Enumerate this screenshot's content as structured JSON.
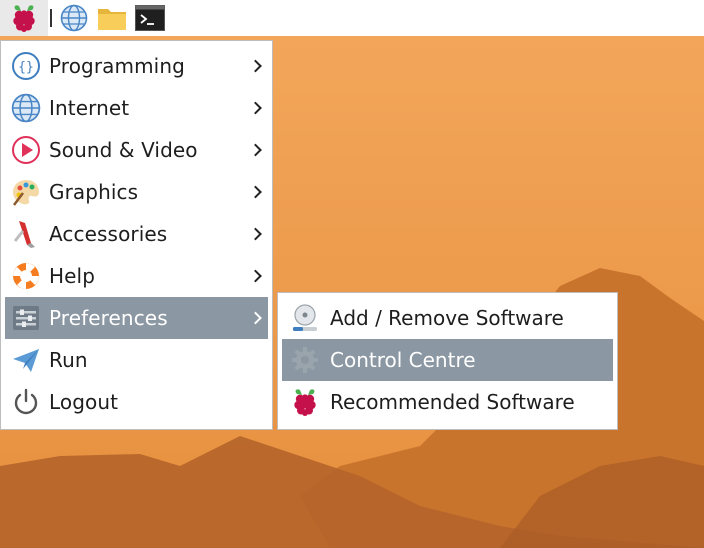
{
  "taskbar": {
    "menu_icon": "raspberry-icon",
    "launchers": [
      "globe-icon",
      "folder-icon",
      "terminal-icon"
    ]
  },
  "menu": {
    "items": [
      {
        "label": "Programming",
        "icon": "programming-icon",
        "submenu": true
      },
      {
        "label": "Internet",
        "icon": "globe-icon",
        "submenu": true
      },
      {
        "label": "Sound & Video",
        "icon": "play-icon",
        "submenu": true
      },
      {
        "label": "Graphics",
        "icon": "palette-icon",
        "submenu": true
      },
      {
        "label": "Accessories",
        "icon": "knife-icon",
        "submenu": true
      },
      {
        "label": "Help",
        "icon": "lifebuoy-icon",
        "submenu": true
      },
      {
        "label": "Preferences",
        "icon": "preferences-icon",
        "submenu": true,
        "active": true
      },
      {
        "label": "Run",
        "icon": "paper-plane-icon",
        "submenu": false
      },
      {
        "label": "Logout",
        "icon": "power-icon",
        "submenu": false
      }
    ]
  },
  "submenu": {
    "items": [
      {
        "label": "Add / Remove Software",
        "icon": "software-disc-icon"
      },
      {
        "label": "Control Centre",
        "icon": "gear-icon",
        "active": true
      },
      {
        "label": "Recommended Software",
        "icon": "raspberry-icon"
      }
    ]
  },
  "colors": {
    "highlight": "#8b97a2",
    "desktop": "#e9923f"
  }
}
